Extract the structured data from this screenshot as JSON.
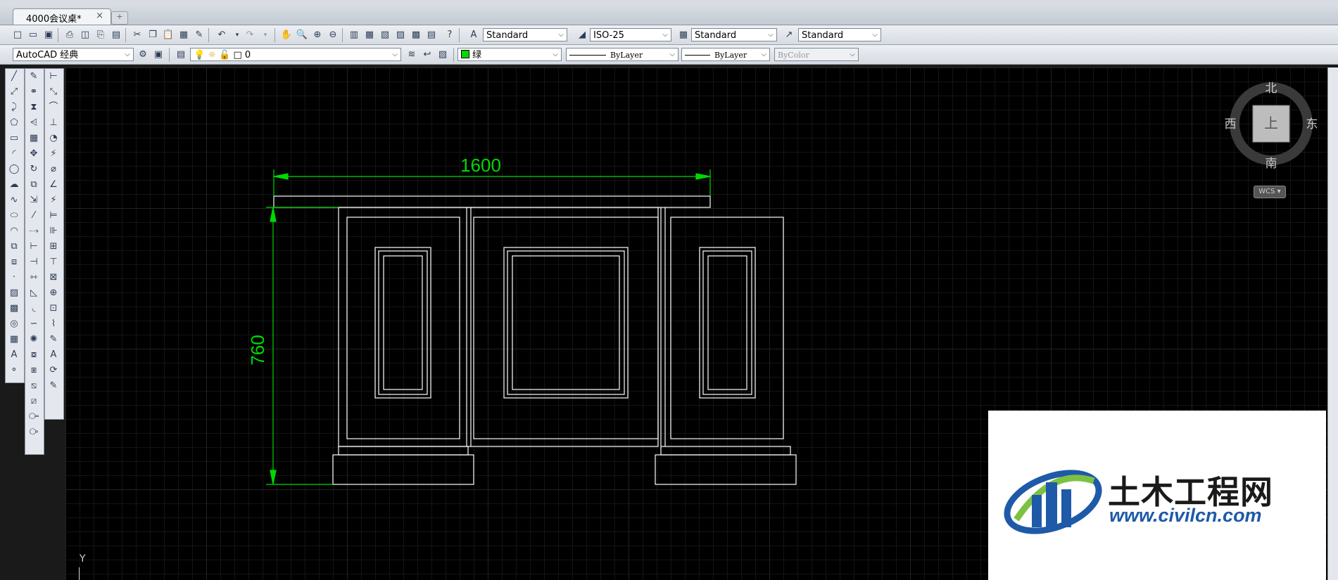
{
  "document_tab": {
    "title": "4000会议桌*",
    "close": "×"
  },
  "toolbar1": {
    "text_style": "Standard",
    "dim_style": "ISO-25",
    "table_style": "Standard",
    "multileader_style": "Standard"
  },
  "toolbar2": {
    "workspace": "AutoCAD 经典",
    "layer": "0",
    "color": "绿",
    "linetype": "ByLayer",
    "lineweight": "ByLayer",
    "plotstyle": "ByColor"
  },
  "drawing": {
    "dim_width": "1600",
    "dim_height": "760",
    "colors": {
      "dimension": "#00d800",
      "geometry": "#ffffff",
      "background": "#000000"
    }
  },
  "viewcube": {
    "north": "北",
    "south": "南",
    "east": "东",
    "west": "西",
    "face": "上",
    "wcs": "WCS"
  },
  "ucs": {
    "y_label": "Y"
  },
  "watermark": {
    "title": "土木工程网",
    "url": "www.civilcn.com"
  },
  "icons": [
    "new-icon",
    "open-icon",
    "save-icon",
    "print-icon",
    "cut-icon",
    "copy-icon",
    "paste-icon",
    "undo-icon",
    "redo-icon",
    "pan-icon",
    "zoom-icon",
    "properties-icon",
    "help-icon",
    "line-icon",
    "circle-icon",
    "arc-icon",
    "rectangle-icon",
    "text-icon",
    "move-icon",
    "rotate-icon",
    "scale-icon",
    "dimension-icon"
  ]
}
